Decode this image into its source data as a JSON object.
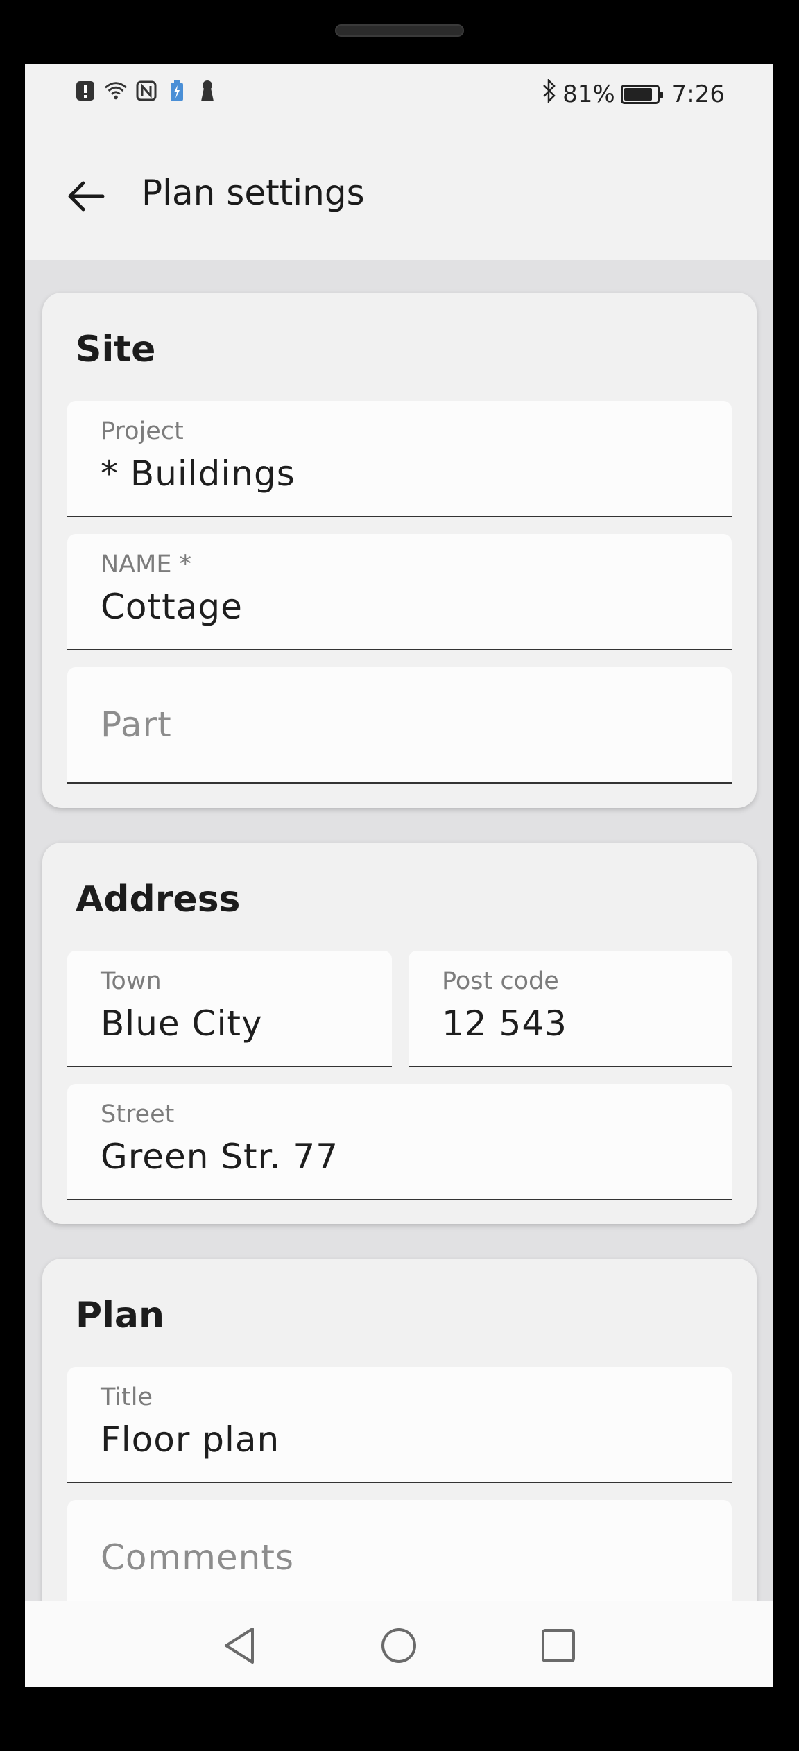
{
  "status_bar": {
    "battery_percent": "81%",
    "time": "7:26",
    "icons_left": [
      "alert-icon",
      "wifi-icon",
      "nfc-icon",
      "battery-saver-icon",
      "keyhole-icon"
    ],
    "icons_right": [
      "bluetooth-icon",
      "battery-icon"
    ]
  },
  "app_bar": {
    "title": "Plan settings",
    "back_icon": "arrow-left-icon"
  },
  "site": {
    "heading": "Site",
    "project_label": "Project",
    "project_value": "* Buildings",
    "name_label": "NAME *",
    "name_value": "Cottage",
    "part_placeholder": "Part"
  },
  "address": {
    "heading": "Address",
    "town_label": "Town",
    "town_value": "Blue City",
    "postcode_label": "Post code",
    "postcode_value": "12 543",
    "street_label": "Street",
    "street_value": "Green Str. 77"
  },
  "plan": {
    "heading": "Plan",
    "title_label": "Title",
    "title_value": "Floor plan",
    "comments_placeholder": "Comments"
  },
  "nav_bar": {
    "icons": [
      "back-triangle-icon",
      "home-circle-icon",
      "recents-square-icon"
    ]
  },
  "colors": {
    "screen_bg": "#e1e1e3",
    "card_bg": "#f1f1f1",
    "field_bg": "#fcfcfc",
    "text_primary": "#1e1e1e",
    "label_gray": "#7c7c7c"
  }
}
